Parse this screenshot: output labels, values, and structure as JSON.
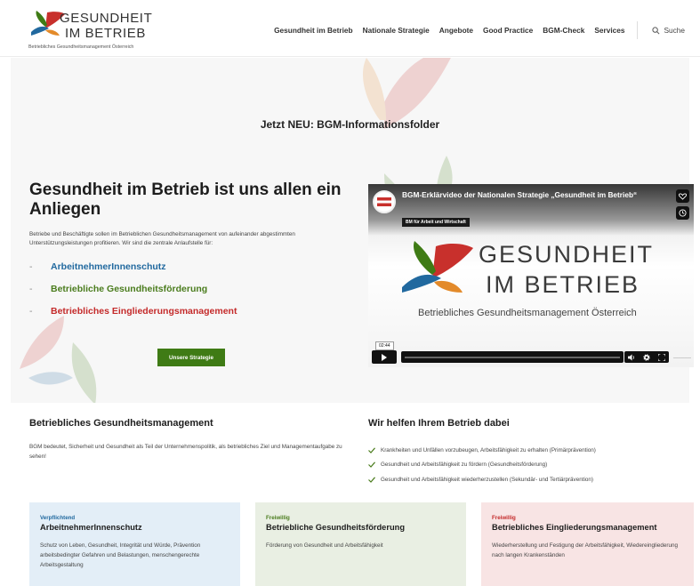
{
  "header": {
    "logo_line1": "GESUNDHEIT",
    "logo_line2": "IM BETRIEB",
    "logo_sub": "Betriebliches Gesundheitsmanagement Österreich",
    "nav": [
      "Gesundheit im Betrieb",
      "Nationale Strategie",
      "Angebote",
      "Good Practice",
      "BGM-Check",
      "Services"
    ],
    "search_label": "Suche"
  },
  "hero": {
    "notice": "Jetzt NEU: BGM-Informationsfolder",
    "title": "Gesundheit im Betrieb ist uns allen ein Anliegen",
    "text": "Betriebe und Beschäftigte sollen im Betrieblichen Gesundheitsmanagement von aufeinander abgestimmten Unterstützungsleistungen profitieren. Wir sind die zentrale Anlaufstelle für:",
    "list": [
      "ArbeitnehmerInnenschutz",
      "Betriebliche Gesundheitsförderung",
      "Betriebliches Eingliederungsmanagement"
    ],
    "cta": "Unsere Strategie"
  },
  "video": {
    "title": "BGM-Erklärvideo der Nationalen Strategie „Gesundheit im Betrieb“",
    "channel": "BM für Arbeit und Wirtschaft",
    "logo_line1": "GESUNDHEIT",
    "logo_line2": "IM BETRIEB",
    "logo_sub": "Betriebliches Gesundheitsmanagement Österreich",
    "time": "02:44"
  },
  "info": {
    "left_title": "Betriebliches Gesundheitsmanagement",
    "left_text": "BGM bedeutet, Sicherheit und Gesundheit als Teil der Unternehmenspolitik, als betriebliches Ziel und Managementaufgabe zu sehen!",
    "right_title": "Wir helfen Ihrem Betrieb dabei",
    "checks": [
      "Krankheiten und Unfällen vorzubeugen, Arbeitsfähigkeit zu erhalten (Primärprävention)",
      "Gesundheit und Arbeitsfähigkeit zu fördern (Gesundheitsförderung)",
      "Gesundheit und Arbeitsfähigkeit wiederherzustellen (Sekundär- und Tertiärprävention)"
    ]
  },
  "cards": [
    {
      "tag": "Verpflichtend",
      "title": "ArbeitnehmerInnenschutz",
      "text": "Schutz von Leben, Gesundheit, Integrität und Würde, Prävention arbeitsbedingter Gefahren und Belastungen, menschengerechte Arbeitsgestaltung"
    },
    {
      "tag": "Freiwillig",
      "title": "Betriebliche Gesundheitsförderung",
      "text": "Förderung von Gesundheit und Arbeitsfähigkeit"
    },
    {
      "tag": "Freiwillig",
      "title": "Betriebliches Eingliederungsmanagement",
      "text": "Wiederherstellung und Festigung der Arbeitsfähigkeit, Wiedereingliederung nach langen Krankenständen"
    }
  ],
  "colors": {
    "blue": "#21699f",
    "green": "#4a7c1d",
    "red": "#c42a2a",
    "button": "#3f7b15",
    "card_blue_bg": "#e3eef7",
    "card_green_bg": "#e9efe3",
    "card_red_bg": "#f8e4e4"
  },
  "icons": [
    "logo-leaves-icon",
    "search-icon",
    "heart-icon",
    "clock-icon",
    "play-icon",
    "volume-icon",
    "settings-icon",
    "fullscreen-icon",
    "check-icon"
  ]
}
